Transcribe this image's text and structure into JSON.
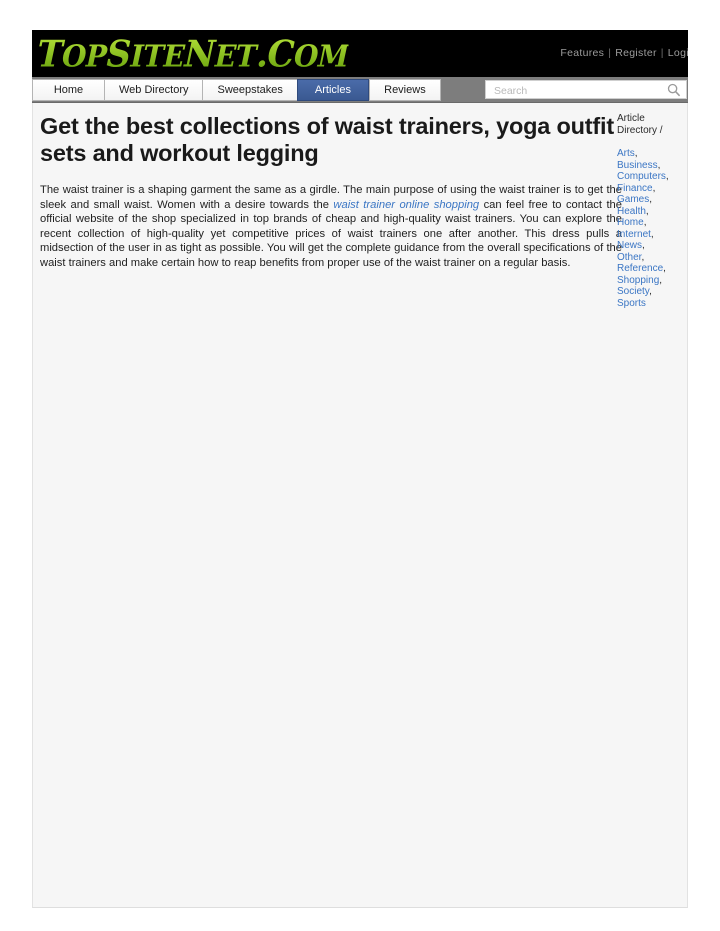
{
  "header": {
    "logo_text": "TopSiteNet.Com",
    "logo_parts": [
      {
        "cap": "T",
        "rest": "OP"
      },
      {
        "cap": "S",
        "rest": "ITE"
      },
      {
        "cap": "N",
        "rest": "ET"
      },
      {
        "cap": ".C",
        "rest": "OM"
      }
    ],
    "top_links": [
      {
        "label": "Features",
        "name": "features-link"
      },
      {
        "label": "Register",
        "name": "register-link"
      },
      {
        "label": "Login",
        "name": "login-link"
      }
    ],
    "link_separator": "|"
  },
  "nav": {
    "tabs": [
      {
        "label": "Home",
        "active": false
      },
      {
        "label": "Web Directory",
        "active": false
      },
      {
        "label": "Sweepstakes",
        "active": false
      },
      {
        "label": "Articles",
        "active": true
      },
      {
        "label": "Reviews",
        "active": false
      }
    ],
    "active_tab": "Articles"
  },
  "search": {
    "placeholder": "Search",
    "value": "",
    "icon": "search-icon"
  },
  "article": {
    "title": "Get the best collections of waist trainers, yoga outfit sets and workout legging",
    "paragraph_before_link": "The waist trainer is a shaping garment the same as a girdle. The main purpose of using the waist trainer is to get the sleek and small waist. Women with a desire towards the ",
    "inline_link": "waist trainer online shopping",
    "paragraph_after_link": " can feel free to contact the official website of the shop specialized in top brands of cheap and high-quality waist trainers. You can explore the recent collection of high-quality yet competitive prices of waist trainers one after another. This dress pulls a midsection of the user in as tight as possible. You will get the complete guidance from the overall specifications of the waist trainers and make certain how to reap benefits from proper use of the waist trainer on a regular basis."
  },
  "sidebar": {
    "heading": "Article Directory /",
    "categories": [
      "Arts",
      "Business",
      "Computers",
      "Finance",
      "Games",
      "Health",
      "Home",
      "Internet",
      "News",
      "Other",
      "Reference",
      "Shopping",
      "Society",
      "Sports"
    ],
    "separator": ","
  },
  "colors": {
    "masthead_bg": "#000000",
    "logo_green": "#8dc21f",
    "nav_strip": "#7d7d7d",
    "active_tab": "#41619e",
    "link_blue": "#3b76c4",
    "content_bg": "#f6f6f6"
  }
}
